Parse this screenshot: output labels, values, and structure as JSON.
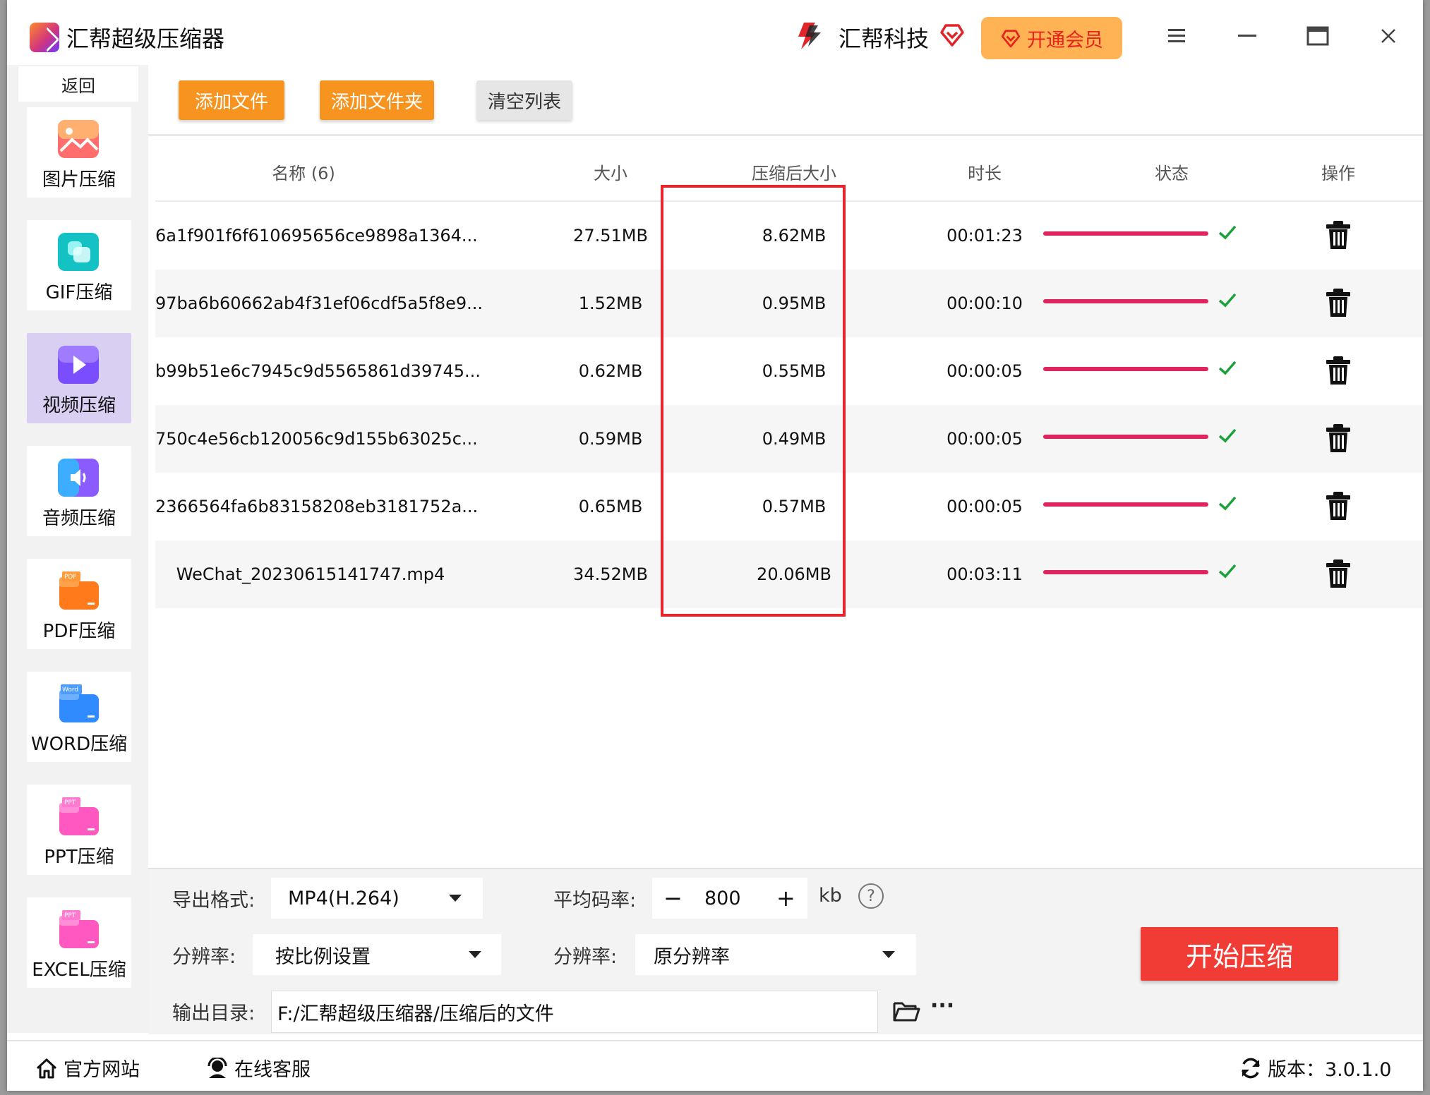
{
  "app": {
    "title": "汇帮超级压缩器"
  },
  "brand": {
    "name": "汇帮科技"
  },
  "vip": {
    "label": "开通会员"
  },
  "sidebar": {
    "back": "返回",
    "items": [
      {
        "label": "图片压缩",
        "icon": "image-icon",
        "color": "#ff6a6a"
      },
      {
        "label": "GIF压缩",
        "icon": "gif-icon",
        "color": "#18c7c9"
      },
      {
        "label": "视频压缩",
        "icon": "video-play-icon",
        "color": "#7a55ff",
        "active": true
      },
      {
        "label": "音频压缩",
        "icon": "audio-icon",
        "color": "#3aa8ff"
      },
      {
        "label": "PDF压缩",
        "icon": "pdf-folder-icon",
        "color": "#ff8a1e",
        "tag": "PDF"
      },
      {
        "label": "WORD压缩",
        "icon": "word-folder-icon",
        "color": "#2f8bff",
        "tag": "Word"
      },
      {
        "label": "PPT压缩",
        "icon": "ppt-folder-icon",
        "color": "#ff5fc2",
        "tag": "PPT"
      },
      {
        "label": "EXCEL压缩",
        "icon": "excel-folder-icon",
        "color": "#ff5fc2",
        "tag": "PPT"
      }
    ]
  },
  "toolbar": {
    "add_file": "添加文件",
    "add_folder": "添加文件夹",
    "clear_list": "清空列表"
  },
  "table": {
    "headers": {
      "name": "名称 (6)",
      "size": "大小",
      "compressed": "压缩后大小",
      "duration": "时长",
      "status": "状态",
      "action": "操作"
    },
    "rows": [
      {
        "name": "6a1f901f6f610695656ce9898a1364...",
        "size": "27.51MB",
        "compressed": "8.62MB",
        "duration": "00:01:23",
        "progress": 1.0
      },
      {
        "name": "97ba6b60662ab4f31ef06cdf5a5f8e9...",
        "size": "1.52MB",
        "compressed": "0.95MB",
        "duration": "00:00:10",
        "progress": 1.0
      },
      {
        "name": "b99b51e6c7945c9d5565861d39745...",
        "size": "0.62MB",
        "compressed": "0.55MB",
        "duration": "00:00:05",
        "progress": 1.0
      },
      {
        "name": "750c4e56cb120056c9d155b63025c...",
        "size": "0.59MB",
        "compressed": "0.49MB",
        "duration": "00:00:05",
        "progress": 1.0
      },
      {
        "name": "2366564fa6b83158208eb3181752a...",
        "size": "0.65MB",
        "compressed": "0.57MB",
        "duration": "00:00:05",
        "progress": 1.0
      },
      {
        "name": "WeChat_20230615141747.mp4",
        "size": "34.52MB",
        "compressed": "20.06MB",
        "duration": "00:03:11",
        "progress": 1.0
      }
    ]
  },
  "settings": {
    "format_label": "导出格式:",
    "format_value": "MP4(H.264)",
    "bitrate_label": "平均码率:",
    "bitrate_minus": "−",
    "bitrate_value": "800",
    "bitrate_plus": "+",
    "bitrate_unit": "kb",
    "help": "?",
    "res_label_1": "分辨率:",
    "res_value_1": "按比例设置",
    "res_label_2": "分辨率:",
    "res_value_2": "原分辨率",
    "output_label": "输出目录:",
    "output_value": "F:/汇帮超级压缩器/压缩后的文件",
    "more": "···",
    "start": "开始压缩"
  },
  "footer": {
    "website": "官方网站",
    "service": "在线客服",
    "version": "版本：3.0.1.0"
  },
  "colors": {
    "accent_orange": "#f79420",
    "start_red": "#f13c35",
    "progress": "#e0245e",
    "check": "#1aa33a",
    "highlight": "#e8252c"
  }
}
